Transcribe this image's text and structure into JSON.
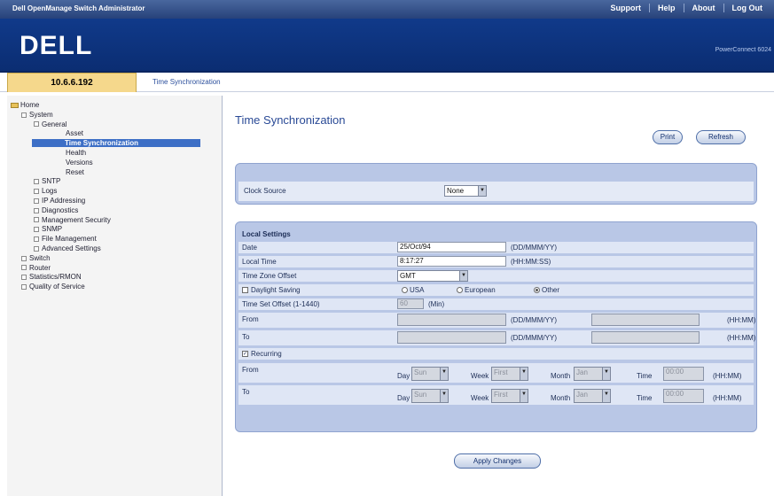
{
  "topbar": {
    "title": "Dell OpenManage Switch Administrator",
    "links": [
      "Support",
      "Help",
      "About",
      "Log Out"
    ]
  },
  "brand": {
    "logo": "DELL",
    "product": "PowerConnect 6024"
  },
  "address": {
    "ip": "10.6.6.192",
    "crumb": "Time Synchronization"
  },
  "tree": [
    {
      "label": "Home",
      "depth": 0,
      "icon": "folder-icon"
    },
    {
      "label": "System",
      "depth": 1,
      "expander": "minus"
    },
    {
      "label": "General",
      "depth": 2,
      "expander": "minus"
    },
    {
      "label": "Asset",
      "depth": 3
    },
    {
      "label": "Time Synchronization",
      "depth": 3,
      "selected": true
    },
    {
      "label": "Health",
      "depth": 3
    },
    {
      "label": "Versions",
      "depth": 3
    },
    {
      "label": "Reset",
      "depth": 3
    },
    {
      "label": "SNTP",
      "depth": 2,
      "expander": "plus"
    },
    {
      "label": "Logs",
      "depth": 2,
      "expander": "plus"
    },
    {
      "label": "IP Addressing",
      "depth": 2,
      "expander": "plus"
    },
    {
      "label": "Diagnostics",
      "depth": 2,
      "expander": "plus"
    },
    {
      "label": "Management Security",
      "depth": 2,
      "expander": "plus"
    },
    {
      "label": "SNMP",
      "depth": 2,
      "expander": "plus"
    },
    {
      "label": "File Management",
      "depth": 2,
      "expander": "plus"
    },
    {
      "label": "Advanced Settings",
      "depth": 2,
      "expander": "plus"
    },
    {
      "label": "Switch",
      "depth": 1,
      "expander": "plus"
    },
    {
      "label": "Router",
      "depth": 1,
      "expander": "plus"
    },
    {
      "label": "Statistics/RMON",
      "depth": 1,
      "expander": "plus"
    },
    {
      "label": "Quality of Service",
      "depth": 1,
      "expander": "plus"
    }
  ],
  "page": {
    "title": "Time Synchronization",
    "print_label": "Print",
    "refresh_label": "Refresh",
    "clock_source_label": "Clock Source",
    "clock_source_value": "None",
    "local_settings_heading": "Local Settings",
    "date_label": "Date",
    "date_value": "25/Oct/94",
    "date_format": "(DD/MMM/YY)",
    "time_label": "Local Time",
    "time_value": "8:17:27",
    "time_format": "(HH:MM:SS)",
    "tz_label": "Time Zone Offset",
    "tz_value": "GMT",
    "dst_label": "Daylight Saving",
    "dst_usa": "USA",
    "dst_european": "European",
    "dst_other": "Other",
    "tso_label": "Time Set Offset (1-1440)",
    "tso_value": "60",
    "tso_unit": "(Min)",
    "from_label": "From",
    "to_label": "To",
    "ddmmmyy": "(DD/MMM/YY)",
    "hhmm": "(HH:MM)",
    "recurring_label": "Recurring",
    "day_label": "Day",
    "week_label": "Week",
    "month_label": "Month",
    "time_short_label": "Time",
    "rec_from": {
      "day": "Sun",
      "week": "First",
      "month": "Jan",
      "time": "00:00"
    },
    "rec_to": {
      "day": "Sun",
      "week": "First",
      "month": "Jan",
      "time": "00:00"
    },
    "apply_label": "Apply Changes"
  }
}
